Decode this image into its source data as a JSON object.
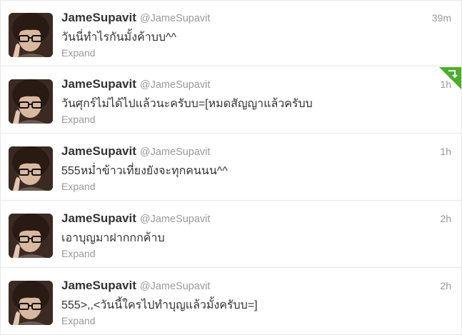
{
  "timeline": {
    "tweets": [
      {
        "fullname": "JameSupavit",
        "username": "@JameSupavit",
        "time": "39m",
        "text": "วันนี่ทำไรกันมั้งค้าบบ^^",
        "expand": "Expand",
        "retweeted_badge": false
      },
      {
        "fullname": "JameSupavit",
        "username": "@JameSupavit",
        "time": "1h",
        "text": "วันศุกร์ไม่ได้ไปแล้วนะครับบ=[หมดสัญญาแล้วครับบ",
        "expand": "Expand",
        "retweeted_badge": true
      },
      {
        "fullname": "JameSupavit",
        "username": "@JameSupavit",
        "time": "1h",
        "text": "555หม่ำข้าวเที่ยงยังจะทุกคนนน^^",
        "expand": "Expand",
        "retweeted_badge": false
      },
      {
        "fullname": "JameSupavit",
        "username": "@JameSupavit",
        "time": "2h",
        "text": "เอาบุญมาฝากกกค้าบ",
        "expand": "Expand",
        "retweeted_badge": false
      },
      {
        "fullname": "JameSupavit",
        "username": "@JameSupavit",
        "time": "2h",
        "text": "555>,,<วันนี้ใครไปทำบุญแล้วมั้งครับบ=]",
        "expand": "Expand",
        "retweeted_badge": false
      }
    ]
  },
  "colors": {
    "fullname": "#333333",
    "muted": "#999999",
    "badge": "#4cae2a",
    "divider": "#e8e8e8"
  }
}
